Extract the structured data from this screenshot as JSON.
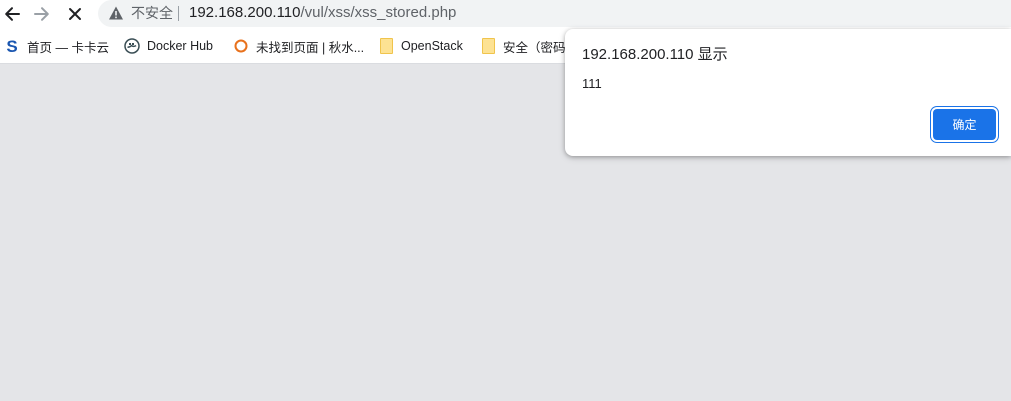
{
  "toolbar": {
    "back_icon": "arrow-left-icon",
    "forward_icon": "arrow-right-icon",
    "stop_icon": "close-x-icon",
    "security_icon": "warning-triangle-icon",
    "security_label": "不安全",
    "url_host": "192.168.200.110",
    "url_path": "/vul/xss/xss_stored.php"
  },
  "bookmarks": [
    {
      "icon": "kakayun-s-icon",
      "label": "首页 — 卡卡云"
    },
    {
      "icon": "docker-hub-icon",
      "label": "Docker Hub"
    },
    {
      "icon": "orange-ring-icon",
      "label": "未找到页面 | 秋水..."
    },
    {
      "icon": "folder-icon",
      "label": "OpenStack"
    },
    {
      "icon": "folder-icon",
      "label": "安全（密码"
    }
  ],
  "dialog": {
    "title": "192.168.200.110 显示",
    "message": "111",
    "ok_label": "确定"
  },
  "colors": {
    "page_background": "#e4e5e8",
    "button_blue": "#1a73e8",
    "kakayun_blue": "#1a56b0",
    "ring_orange": "#e8711c"
  }
}
